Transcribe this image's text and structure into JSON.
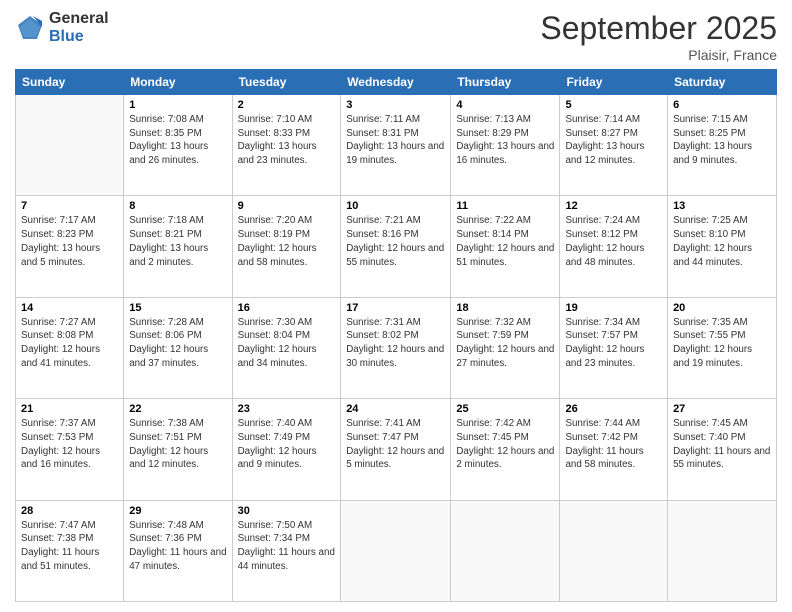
{
  "logo": {
    "general": "General",
    "blue": "Blue"
  },
  "header": {
    "month": "September 2025",
    "location": "Plaisir, France"
  },
  "days_of_week": [
    "Sunday",
    "Monday",
    "Tuesday",
    "Wednesday",
    "Thursday",
    "Friday",
    "Saturday"
  ],
  "weeks": [
    [
      {
        "day": "",
        "sunrise": "",
        "sunset": "",
        "daylight": ""
      },
      {
        "day": "1",
        "sunrise": "Sunrise: 7:08 AM",
        "sunset": "Sunset: 8:35 PM",
        "daylight": "Daylight: 13 hours and 26 minutes."
      },
      {
        "day": "2",
        "sunrise": "Sunrise: 7:10 AM",
        "sunset": "Sunset: 8:33 PM",
        "daylight": "Daylight: 13 hours and 23 minutes."
      },
      {
        "day": "3",
        "sunrise": "Sunrise: 7:11 AM",
        "sunset": "Sunset: 8:31 PM",
        "daylight": "Daylight: 13 hours and 19 minutes."
      },
      {
        "day": "4",
        "sunrise": "Sunrise: 7:13 AM",
        "sunset": "Sunset: 8:29 PM",
        "daylight": "Daylight: 13 hours and 16 minutes."
      },
      {
        "day": "5",
        "sunrise": "Sunrise: 7:14 AM",
        "sunset": "Sunset: 8:27 PM",
        "daylight": "Daylight: 13 hours and 12 minutes."
      },
      {
        "day": "6",
        "sunrise": "Sunrise: 7:15 AM",
        "sunset": "Sunset: 8:25 PM",
        "daylight": "Daylight: 13 hours and 9 minutes."
      }
    ],
    [
      {
        "day": "7",
        "sunrise": "Sunrise: 7:17 AM",
        "sunset": "Sunset: 8:23 PM",
        "daylight": "Daylight: 13 hours and 5 minutes."
      },
      {
        "day": "8",
        "sunrise": "Sunrise: 7:18 AM",
        "sunset": "Sunset: 8:21 PM",
        "daylight": "Daylight: 13 hours and 2 minutes."
      },
      {
        "day": "9",
        "sunrise": "Sunrise: 7:20 AM",
        "sunset": "Sunset: 8:19 PM",
        "daylight": "Daylight: 12 hours and 58 minutes."
      },
      {
        "day": "10",
        "sunrise": "Sunrise: 7:21 AM",
        "sunset": "Sunset: 8:16 PM",
        "daylight": "Daylight: 12 hours and 55 minutes."
      },
      {
        "day": "11",
        "sunrise": "Sunrise: 7:22 AM",
        "sunset": "Sunset: 8:14 PM",
        "daylight": "Daylight: 12 hours and 51 minutes."
      },
      {
        "day": "12",
        "sunrise": "Sunrise: 7:24 AM",
        "sunset": "Sunset: 8:12 PM",
        "daylight": "Daylight: 12 hours and 48 minutes."
      },
      {
        "day": "13",
        "sunrise": "Sunrise: 7:25 AM",
        "sunset": "Sunset: 8:10 PM",
        "daylight": "Daylight: 12 hours and 44 minutes."
      }
    ],
    [
      {
        "day": "14",
        "sunrise": "Sunrise: 7:27 AM",
        "sunset": "Sunset: 8:08 PM",
        "daylight": "Daylight: 12 hours and 41 minutes."
      },
      {
        "day": "15",
        "sunrise": "Sunrise: 7:28 AM",
        "sunset": "Sunset: 8:06 PM",
        "daylight": "Daylight: 12 hours and 37 minutes."
      },
      {
        "day": "16",
        "sunrise": "Sunrise: 7:30 AM",
        "sunset": "Sunset: 8:04 PM",
        "daylight": "Daylight: 12 hours and 34 minutes."
      },
      {
        "day": "17",
        "sunrise": "Sunrise: 7:31 AM",
        "sunset": "Sunset: 8:02 PM",
        "daylight": "Daylight: 12 hours and 30 minutes."
      },
      {
        "day": "18",
        "sunrise": "Sunrise: 7:32 AM",
        "sunset": "Sunset: 7:59 PM",
        "daylight": "Daylight: 12 hours and 27 minutes."
      },
      {
        "day": "19",
        "sunrise": "Sunrise: 7:34 AM",
        "sunset": "Sunset: 7:57 PM",
        "daylight": "Daylight: 12 hours and 23 minutes."
      },
      {
        "day": "20",
        "sunrise": "Sunrise: 7:35 AM",
        "sunset": "Sunset: 7:55 PM",
        "daylight": "Daylight: 12 hours and 19 minutes."
      }
    ],
    [
      {
        "day": "21",
        "sunrise": "Sunrise: 7:37 AM",
        "sunset": "Sunset: 7:53 PM",
        "daylight": "Daylight: 12 hours and 16 minutes."
      },
      {
        "day": "22",
        "sunrise": "Sunrise: 7:38 AM",
        "sunset": "Sunset: 7:51 PM",
        "daylight": "Daylight: 12 hours and 12 minutes."
      },
      {
        "day": "23",
        "sunrise": "Sunrise: 7:40 AM",
        "sunset": "Sunset: 7:49 PM",
        "daylight": "Daylight: 12 hours and 9 minutes."
      },
      {
        "day": "24",
        "sunrise": "Sunrise: 7:41 AM",
        "sunset": "Sunset: 7:47 PM",
        "daylight": "Daylight: 12 hours and 5 minutes."
      },
      {
        "day": "25",
        "sunrise": "Sunrise: 7:42 AM",
        "sunset": "Sunset: 7:45 PM",
        "daylight": "Daylight: 12 hours and 2 minutes."
      },
      {
        "day": "26",
        "sunrise": "Sunrise: 7:44 AM",
        "sunset": "Sunset: 7:42 PM",
        "daylight": "Daylight: 11 hours and 58 minutes."
      },
      {
        "day": "27",
        "sunrise": "Sunrise: 7:45 AM",
        "sunset": "Sunset: 7:40 PM",
        "daylight": "Daylight: 11 hours and 55 minutes."
      }
    ],
    [
      {
        "day": "28",
        "sunrise": "Sunrise: 7:47 AM",
        "sunset": "Sunset: 7:38 PM",
        "daylight": "Daylight: 11 hours and 51 minutes."
      },
      {
        "day": "29",
        "sunrise": "Sunrise: 7:48 AM",
        "sunset": "Sunset: 7:36 PM",
        "daylight": "Daylight: 11 hours and 47 minutes."
      },
      {
        "day": "30",
        "sunrise": "Sunrise: 7:50 AM",
        "sunset": "Sunset: 7:34 PM",
        "daylight": "Daylight: 11 hours and 44 minutes."
      },
      {
        "day": "",
        "sunrise": "",
        "sunset": "",
        "daylight": ""
      },
      {
        "day": "",
        "sunrise": "",
        "sunset": "",
        "daylight": ""
      },
      {
        "day": "",
        "sunrise": "",
        "sunset": "",
        "daylight": ""
      },
      {
        "day": "",
        "sunrise": "",
        "sunset": "",
        "daylight": ""
      }
    ]
  ]
}
